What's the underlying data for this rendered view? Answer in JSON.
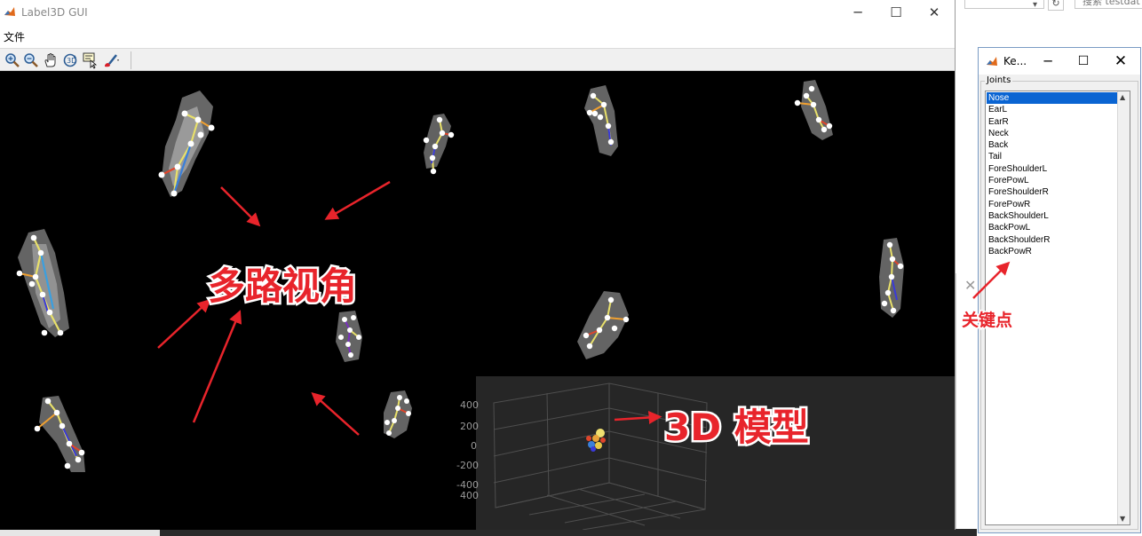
{
  "main_window": {
    "title": "Label3D GUI",
    "minimize": "─",
    "maximize": "☐",
    "close": "✕",
    "menu": [
      "文件"
    ],
    "toolbar": [
      {
        "icon": "zoom-in-icon"
      },
      {
        "icon": "zoom-out-icon"
      },
      {
        "icon": "pan-hand-icon"
      },
      {
        "icon": "rotate-3d-icon"
      },
      {
        "icon": "data-cursor-icon"
      },
      {
        "icon": "brush-icon"
      }
    ]
  },
  "background": {
    "search_placeholder": "搜索 testdat",
    "refresh": "↻",
    "dropdown": "▾",
    "close": "✕"
  },
  "model_3d": {
    "ticks": [
      "400",
      "200",
      "0",
      "-200",
      "-400",
      "400"
    ]
  },
  "annotations": {
    "multi_view": "多路视角",
    "model_3d": "3D 模型",
    "keypoints": "关键点",
    "color": "#e8242b"
  },
  "keypoint_window": {
    "title": "Ke...",
    "minimize": "─",
    "maximize": "☐",
    "close": "✕",
    "group_label": "Joints",
    "selected": "Nose",
    "joints": [
      "Nose",
      "EarL",
      "EarR",
      "Neck",
      "Back",
      "Tail",
      "ForeShoulderL",
      "ForePowL",
      "ForeShoulderR",
      "ForePowR",
      "BackShoulderL",
      "BackPowL",
      "BackShoulderR",
      "BackPowR"
    ]
  }
}
